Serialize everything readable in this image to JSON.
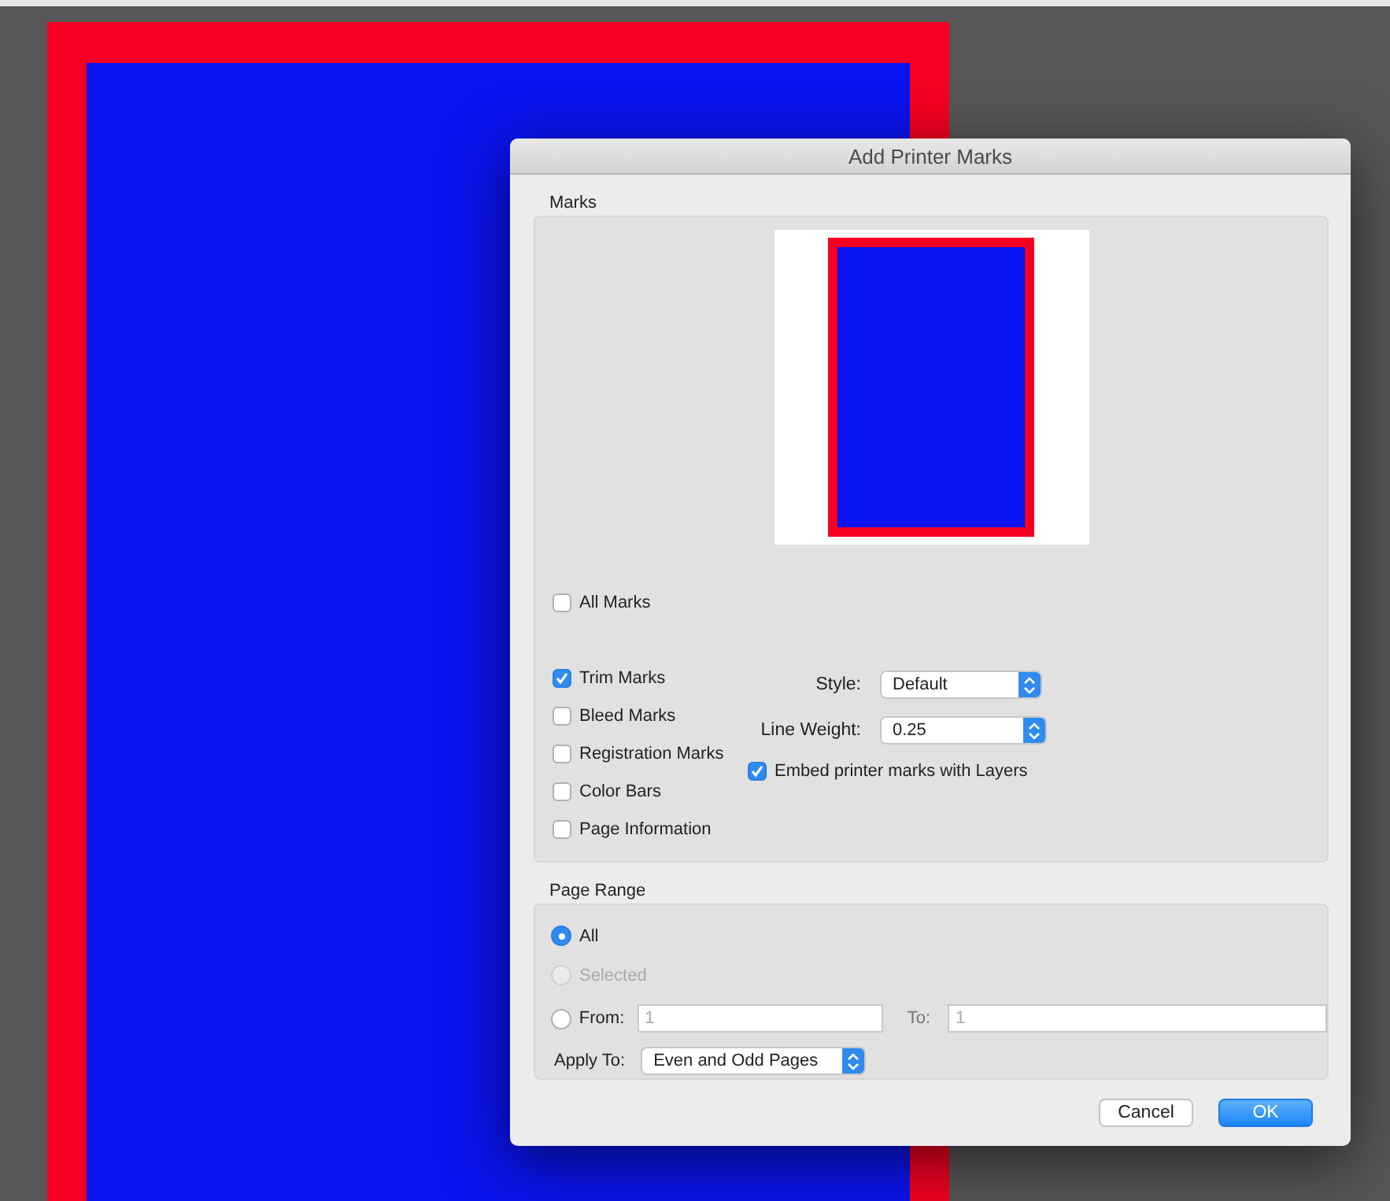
{
  "dialog": {
    "title": "Add Printer Marks",
    "marks": {
      "label": "Marks",
      "all_marks": {
        "label": "All Marks",
        "checked": false
      },
      "options": [
        {
          "label": "Trim Marks",
          "checked": true
        },
        {
          "label": "Bleed Marks",
          "checked": false
        },
        {
          "label": "Registration Marks",
          "checked": false
        },
        {
          "label": "Color Bars",
          "checked": false
        },
        {
          "label": "Page Information",
          "checked": false
        }
      ],
      "style": {
        "label": "Style:",
        "value": "Default"
      },
      "line_weight": {
        "label": "Line Weight:",
        "value": "0.25"
      },
      "embed": {
        "label": "Embed printer marks with Layers",
        "checked": true
      }
    },
    "page_range": {
      "label": "Page Range",
      "options": [
        {
          "label": "All",
          "selected": true,
          "disabled": false
        },
        {
          "label": "Selected",
          "selected": false,
          "disabled": true
        },
        {
          "label": "From:",
          "selected": false,
          "disabled": false
        }
      ],
      "from": {
        "placeholder": "1"
      },
      "to": {
        "label": "To:",
        "placeholder": "1"
      },
      "apply_to": {
        "label": "Apply To:",
        "value": "Even and Odd Pages"
      }
    },
    "buttons": [
      {
        "label": "Cancel",
        "kind": "secondary"
      },
      {
        "label": "OK",
        "kind": "primary"
      }
    ]
  }
}
